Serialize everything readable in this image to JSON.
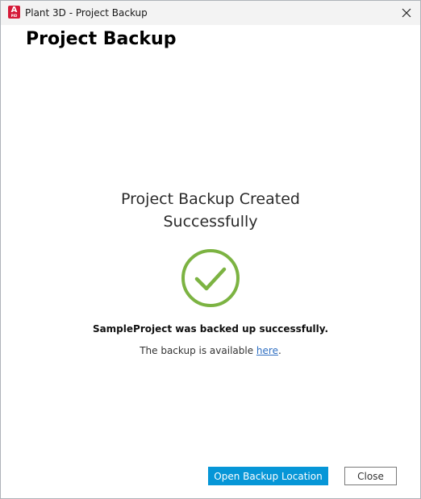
{
  "window": {
    "title": "Plant 3D - Project Backup",
    "app_icon_letter": "A",
    "app_icon_sub": "PID"
  },
  "dialog": {
    "heading": "Project Backup"
  },
  "result": {
    "title_line1": "Project Backup Created",
    "title_line2": "Successfully",
    "icon": "check-circle-icon",
    "message": "SampleProject was backed up successfully.",
    "available_prefix": "The backup is available ",
    "available_link": "here",
    "available_suffix": "."
  },
  "buttons": {
    "open_location": "Open Backup Location",
    "close": "Close"
  },
  "colors": {
    "accent": "#0696d7",
    "success": "#7cb342",
    "link": "#2f6fc2",
    "app_icon": "#d51a38"
  }
}
